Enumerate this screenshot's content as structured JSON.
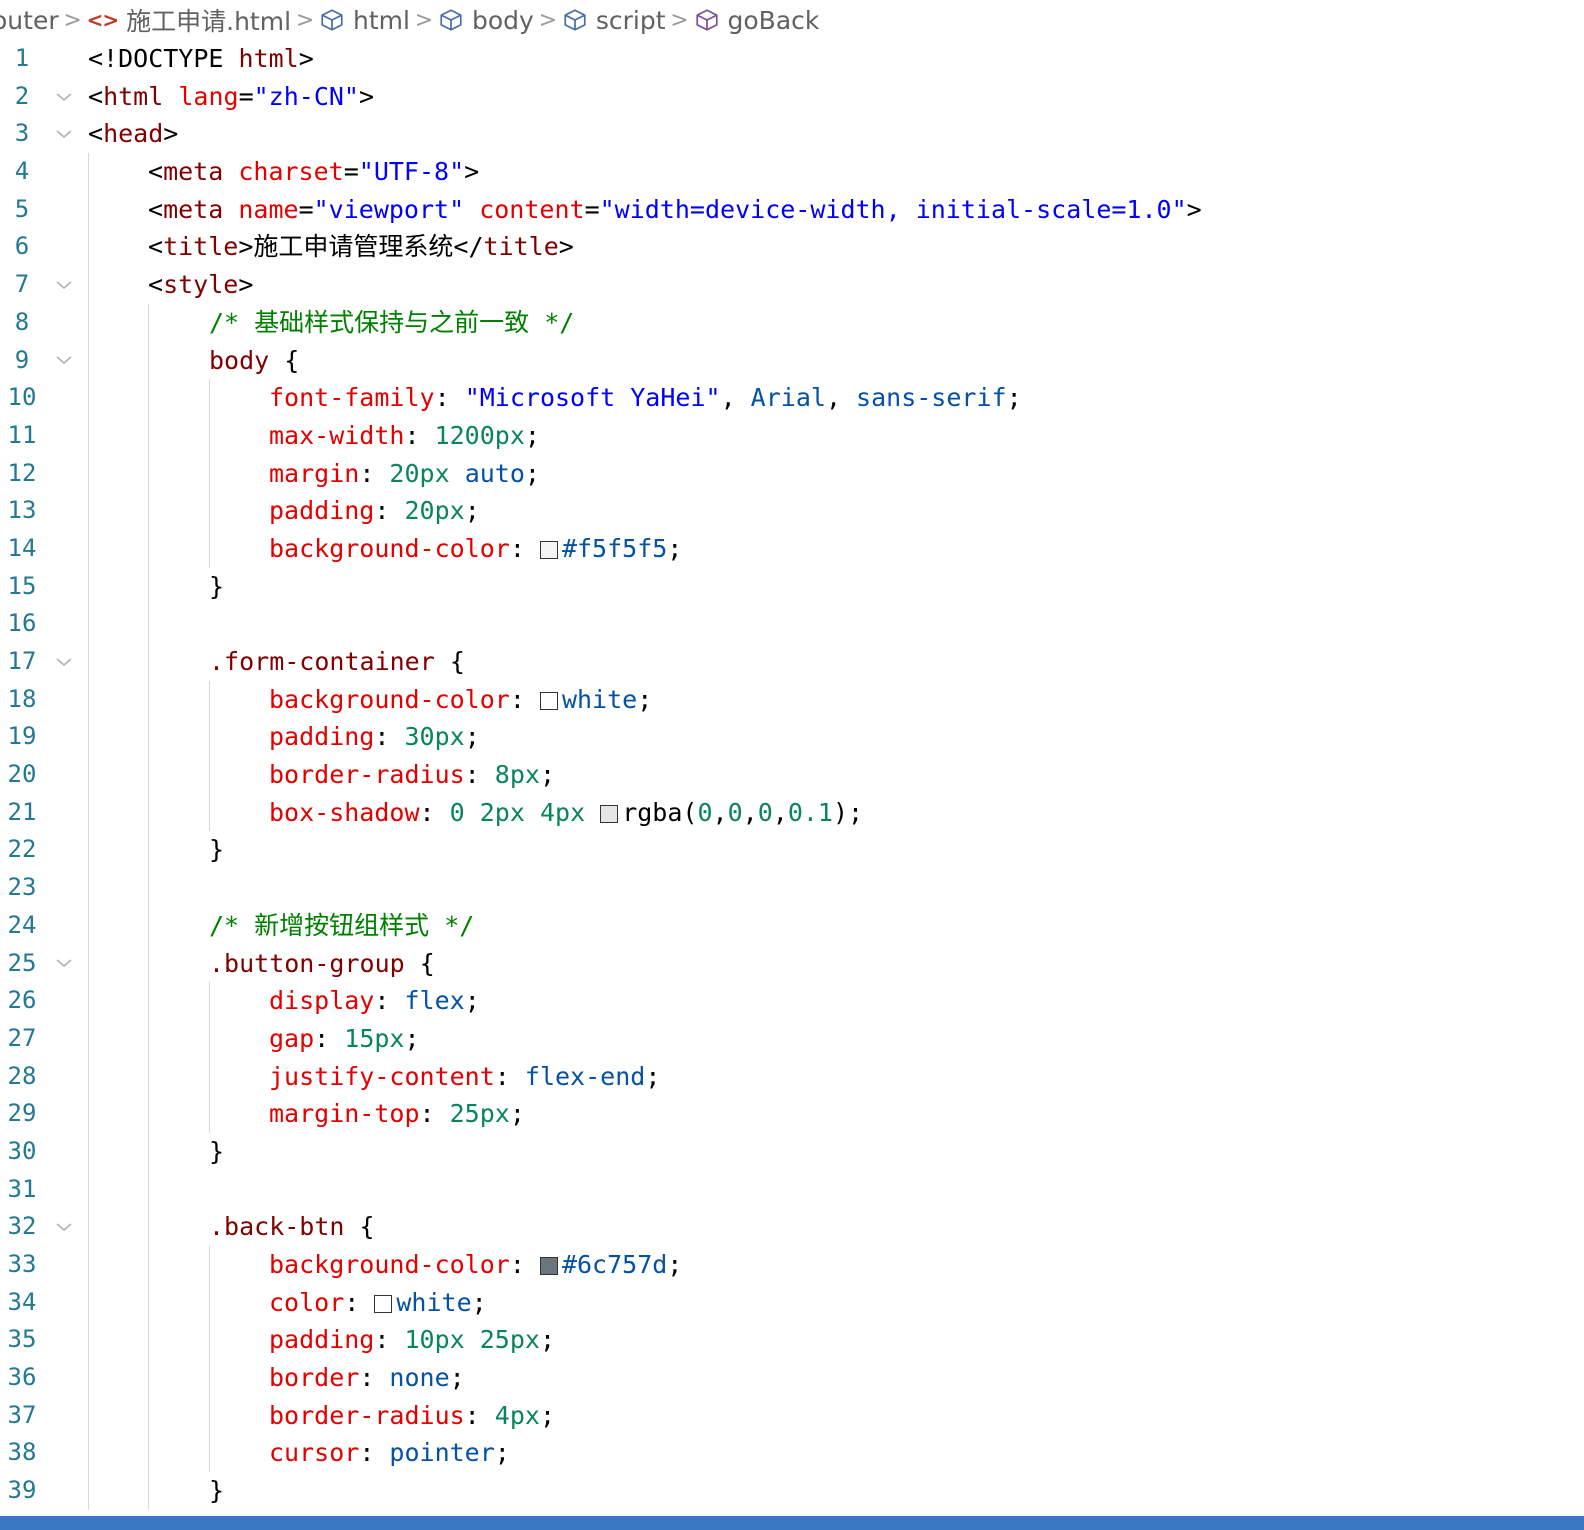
{
  "breadcrumb": {
    "items": [
      {
        "label": "outer",
        "icon": null
      },
      {
        "label": "施工申请.html",
        "icon": "html-code-icon"
      },
      {
        "label": "html",
        "icon": "cube-icon"
      },
      {
        "label": "body",
        "icon": "cube-icon"
      },
      {
        "label": "script",
        "icon": "cube-icon"
      },
      {
        "label": "goBack",
        "icon": "cube-icon"
      }
    ],
    "separator": ">"
  },
  "colors": {
    "line_number": "#237893",
    "tag": "#800000",
    "attribute": "#e50000",
    "string": "#0000ff",
    "property": "#e50000",
    "number": "#098658",
    "keyword": "#0451a5",
    "comment": "#008000",
    "status_bar": "#3b78c4"
  },
  "editor": {
    "lines": [
      {
        "n": "1",
        "indent": 0,
        "fold": false,
        "tokens": [
          [
            "punct",
            "<!DOCTYPE "
          ],
          [
            "tag",
            "html"
          ],
          [
            "punct",
            ">"
          ]
        ]
      },
      {
        "n": "2",
        "indent": 0,
        "fold": true,
        "tokens": [
          [
            "punct",
            "<"
          ],
          [
            "tag",
            "html"
          ],
          [
            "text",
            " "
          ],
          [
            "attr",
            "lang"
          ],
          [
            "punct",
            "="
          ],
          [
            "str",
            "\"zh-CN\""
          ],
          [
            "punct",
            ">"
          ]
        ]
      },
      {
        "n": "3",
        "indent": 0,
        "fold": true,
        "tokens": [
          [
            "punct",
            "<"
          ],
          [
            "tag",
            "head"
          ],
          [
            "punct",
            ">"
          ]
        ]
      },
      {
        "n": "4",
        "indent": 1,
        "fold": false,
        "tokens": [
          [
            "punct",
            "<"
          ],
          [
            "tag",
            "meta"
          ],
          [
            "text",
            " "
          ],
          [
            "attr",
            "charset"
          ],
          [
            "punct",
            "="
          ],
          [
            "str",
            "\"UTF-8\""
          ],
          [
            "punct",
            ">"
          ]
        ]
      },
      {
        "n": "5",
        "indent": 1,
        "fold": false,
        "tokens": [
          [
            "punct",
            "<"
          ],
          [
            "tag",
            "meta"
          ],
          [
            "text",
            " "
          ],
          [
            "attr",
            "name"
          ],
          [
            "punct",
            "="
          ],
          [
            "str",
            "\"viewport\""
          ],
          [
            "text",
            " "
          ],
          [
            "attr",
            "content"
          ],
          [
            "punct",
            "="
          ],
          [
            "str",
            "\"width=device-width, initial-scale=1.0\""
          ],
          [
            "punct",
            ">"
          ]
        ]
      },
      {
        "n": "6",
        "indent": 1,
        "fold": false,
        "tokens": [
          [
            "punct",
            "<"
          ],
          [
            "tag",
            "title"
          ],
          [
            "punct",
            ">"
          ],
          [
            "text",
            "施工申请管理系统"
          ],
          [
            "punct",
            "</"
          ],
          [
            "tag",
            "title"
          ],
          [
            "punct",
            ">"
          ]
        ]
      },
      {
        "n": "7",
        "indent": 1,
        "fold": true,
        "tokens": [
          [
            "punct",
            "<"
          ],
          [
            "tag",
            "style"
          ],
          [
            "punct",
            ">"
          ]
        ]
      },
      {
        "n": "8",
        "indent": 2,
        "fold": false,
        "tokens": [
          [
            "comment",
            "/* 基础样式保持与之前一致 */"
          ]
        ]
      },
      {
        "n": "9",
        "indent": 2,
        "fold": true,
        "tokens": [
          [
            "sel",
            "body"
          ],
          [
            "text",
            " {"
          ]
        ]
      },
      {
        "n": "10",
        "indent": 3,
        "fold": false,
        "tokens": [
          [
            "prop",
            "font-family"
          ],
          [
            "text",
            ": "
          ],
          [
            "str",
            "\"Microsoft YaHei\""
          ],
          [
            "text",
            ", "
          ],
          [
            "kw",
            "Arial"
          ],
          [
            "text",
            ", "
          ],
          [
            "kw",
            "sans-serif"
          ],
          [
            "text",
            ";"
          ]
        ]
      },
      {
        "n": "11",
        "indent": 3,
        "fold": false,
        "tokens": [
          [
            "prop",
            "max-width"
          ],
          [
            "text",
            ": "
          ],
          [
            "num",
            "1200px"
          ],
          [
            "text",
            ";"
          ]
        ]
      },
      {
        "n": "12",
        "indent": 3,
        "fold": false,
        "tokens": [
          [
            "prop",
            "margin"
          ],
          [
            "text",
            ": "
          ],
          [
            "num",
            "20px"
          ],
          [
            "text",
            " "
          ],
          [
            "kw",
            "auto"
          ],
          [
            "text",
            ";"
          ]
        ]
      },
      {
        "n": "13",
        "indent": 3,
        "fold": false,
        "tokens": [
          [
            "prop",
            "padding"
          ],
          [
            "text",
            ": "
          ],
          [
            "num",
            "20px"
          ],
          [
            "text",
            ";"
          ]
        ]
      },
      {
        "n": "14",
        "indent": 3,
        "fold": false,
        "tokens": [
          [
            "prop",
            "background-color"
          ],
          [
            "text",
            ": "
          ],
          [
            "swatch",
            "#f5f5f5"
          ],
          [
            "kw",
            "#f5f5f5"
          ],
          [
            "text",
            ";"
          ]
        ]
      },
      {
        "n": "15",
        "indent": 2,
        "fold": false,
        "tokens": [
          [
            "text",
            "}"
          ]
        ]
      },
      {
        "n": "16",
        "indent": 2,
        "fold": false,
        "tokens": []
      },
      {
        "n": "17",
        "indent": 2,
        "fold": true,
        "tokens": [
          [
            "sel",
            ".form-container"
          ],
          [
            "text",
            " {"
          ]
        ]
      },
      {
        "n": "18",
        "indent": 3,
        "fold": false,
        "tokens": [
          [
            "prop",
            "background-color"
          ],
          [
            "text",
            ": "
          ],
          [
            "swatch",
            "#ffffff"
          ],
          [
            "kw",
            "white"
          ],
          [
            "text",
            ";"
          ]
        ]
      },
      {
        "n": "19",
        "indent": 3,
        "fold": false,
        "tokens": [
          [
            "prop",
            "padding"
          ],
          [
            "text",
            ": "
          ],
          [
            "num",
            "30px"
          ],
          [
            "text",
            ";"
          ]
        ]
      },
      {
        "n": "20",
        "indent": 3,
        "fold": false,
        "tokens": [
          [
            "prop",
            "border-radius"
          ],
          [
            "text",
            ": "
          ],
          [
            "num",
            "8px"
          ],
          [
            "text",
            ";"
          ]
        ]
      },
      {
        "n": "21",
        "indent": 3,
        "fold": false,
        "tokens": [
          [
            "prop",
            "box-shadow"
          ],
          [
            "text",
            ": "
          ],
          [
            "num",
            "0"
          ],
          [
            "text",
            " "
          ],
          [
            "num",
            "2px"
          ],
          [
            "text",
            " "
          ],
          [
            "num",
            "4px"
          ],
          [
            "text",
            " "
          ],
          [
            "swatch",
            "#e6e6e6"
          ],
          [
            "text",
            "rgba("
          ],
          [
            "num",
            "0"
          ],
          [
            "text",
            ","
          ],
          [
            "num",
            "0"
          ],
          [
            "text",
            ","
          ],
          [
            "num",
            "0"
          ],
          [
            "text",
            ","
          ],
          [
            "num",
            "0.1"
          ],
          [
            "text",
            ");"
          ]
        ]
      },
      {
        "n": "22",
        "indent": 2,
        "fold": false,
        "tokens": [
          [
            "text",
            "}"
          ]
        ]
      },
      {
        "n": "23",
        "indent": 2,
        "fold": false,
        "tokens": []
      },
      {
        "n": "24",
        "indent": 2,
        "fold": false,
        "tokens": [
          [
            "comment",
            "/* 新增按钮组样式 */"
          ]
        ]
      },
      {
        "n": "25",
        "indent": 2,
        "fold": true,
        "tokens": [
          [
            "sel",
            ".button-group"
          ],
          [
            "text",
            " {"
          ]
        ]
      },
      {
        "n": "26",
        "indent": 3,
        "fold": false,
        "tokens": [
          [
            "prop",
            "display"
          ],
          [
            "text",
            ": "
          ],
          [
            "kw",
            "flex"
          ],
          [
            "text",
            ";"
          ]
        ]
      },
      {
        "n": "27",
        "indent": 3,
        "fold": false,
        "tokens": [
          [
            "prop",
            "gap"
          ],
          [
            "text",
            ": "
          ],
          [
            "num",
            "15px"
          ],
          [
            "text",
            ";"
          ]
        ]
      },
      {
        "n": "28",
        "indent": 3,
        "fold": false,
        "tokens": [
          [
            "prop",
            "justify-content"
          ],
          [
            "text",
            ": "
          ],
          [
            "kw",
            "flex-end"
          ],
          [
            "text",
            ";"
          ]
        ]
      },
      {
        "n": "29",
        "indent": 3,
        "fold": false,
        "tokens": [
          [
            "prop",
            "margin-top"
          ],
          [
            "text",
            ": "
          ],
          [
            "num",
            "25px"
          ],
          [
            "text",
            ";"
          ]
        ]
      },
      {
        "n": "30",
        "indent": 2,
        "fold": false,
        "tokens": [
          [
            "text",
            "}"
          ]
        ]
      },
      {
        "n": "31",
        "indent": 2,
        "fold": false,
        "tokens": []
      },
      {
        "n": "32",
        "indent": 2,
        "fold": true,
        "tokens": [
          [
            "sel",
            ".back-btn"
          ],
          [
            "text",
            " {"
          ]
        ]
      },
      {
        "n": "33",
        "indent": 3,
        "fold": false,
        "tokens": [
          [
            "prop",
            "background-color"
          ],
          [
            "text",
            ": "
          ],
          [
            "swatch",
            "#6c757d"
          ],
          [
            "kw",
            "#6c757d"
          ],
          [
            "text",
            ";"
          ]
        ]
      },
      {
        "n": "34",
        "indent": 3,
        "fold": false,
        "tokens": [
          [
            "prop",
            "color"
          ],
          [
            "text",
            ": "
          ],
          [
            "swatch",
            "#ffffff"
          ],
          [
            "kw",
            "white"
          ],
          [
            "text",
            ";"
          ]
        ]
      },
      {
        "n": "35",
        "indent": 3,
        "fold": false,
        "tokens": [
          [
            "prop",
            "padding"
          ],
          [
            "text",
            ": "
          ],
          [
            "num",
            "10px"
          ],
          [
            "text",
            " "
          ],
          [
            "num",
            "25px"
          ],
          [
            "text",
            ";"
          ]
        ]
      },
      {
        "n": "36",
        "indent": 3,
        "fold": false,
        "tokens": [
          [
            "prop",
            "border"
          ],
          [
            "text",
            ": "
          ],
          [
            "kw",
            "none"
          ],
          [
            "text",
            ";"
          ]
        ]
      },
      {
        "n": "37",
        "indent": 3,
        "fold": false,
        "tokens": [
          [
            "prop",
            "border-radius"
          ],
          [
            "text",
            ": "
          ],
          [
            "num",
            "4px"
          ],
          [
            "text",
            ";"
          ]
        ]
      },
      {
        "n": "38",
        "indent": 3,
        "fold": false,
        "tokens": [
          [
            "prop",
            "cursor"
          ],
          [
            "text",
            ": "
          ],
          [
            "kw",
            "pointer"
          ],
          [
            "text",
            ";"
          ]
        ]
      },
      {
        "n": "39",
        "indent": 2,
        "fold": false,
        "tokens": [
          [
            "text",
            "}"
          ]
        ]
      }
    ]
  }
}
